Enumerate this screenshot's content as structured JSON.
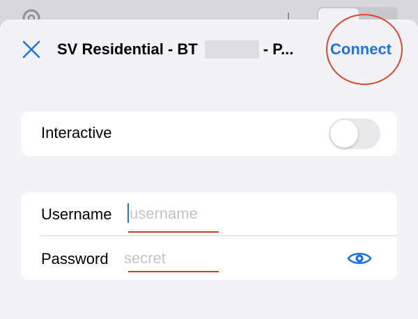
{
  "sheet": {
    "title_prefix": "SV Residential - BT",
    "title_suffix": "- P...",
    "connect_label": "Connect"
  },
  "interactive": {
    "label": "Interactive",
    "enabled": false
  },
  "credentials": {
    "username_label": "Username",
    "username_placeholder": "username",
    "username_value": "",
    "password_label": "Password",
    "password_placeholder": "secret",
    "password_value": ""
  },
  "colors": {
    "accent": "#1a73e8",
    "annotation": "#e0462b",
    "background": "#f2f2f7",
    "card": "#ffffff"
  },
  "icons": {
    "close": "close-icon",
    "reveal": "eye-icon",
    "settings": "gear-icon"
  }
}
